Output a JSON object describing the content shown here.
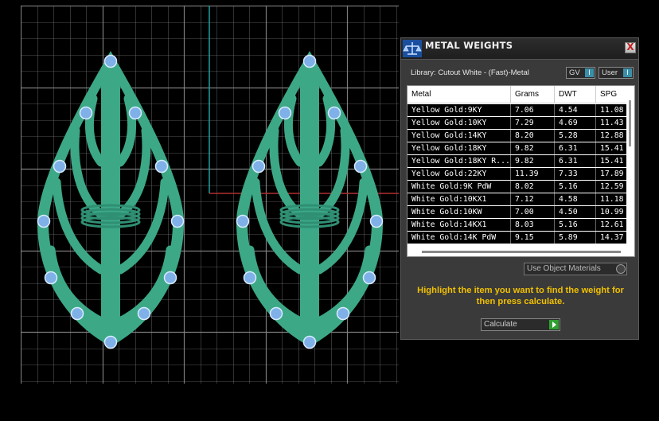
{
  "viewport": {
    "colors": {
      "background": "#000000",
      "grid": "#8a8a8a",
      "axis_x": "#b03030",
      "axis_y": "#20a0a0",
      "model": "#3ca886",
      "model_shade": "#2f8f72",
      "gem": "#7fb0e8"
    }
  },
  "panel": {
    "title": "METAL WEIGHTS",
    "title_icon": "scale-icon",
    "close_label": "X",
    "library_label": "Library: Cutout White - (Fast)-Metal",
    "toggles": {
      "gv": "GV",
      "user": "User"
    },
    "table": {
      "columns": [
        "Metal",
        "Grams",
        "DWT",
        "SPG"
      ],
      "rows": [
        [
          "Yellow Gold:9KY",
          "7.06",
          "4.54",
          "11.08"
        ],
        [
          "Yellow Gold:10KY",
          "7.29",
          "4.69",
          "11.43"
        ],
        [
          "Yellow Gold:14KY",
          "8.20",
          "5.28",
          "12.88"
        ],
        [
          "Yellow Gold:18KY",
          "9.82",
          "6.31",
          "15.41"
        ],
        [
          "Yellow Gold:18KY R...",
          "9.82",
          "6.31",
          "15.41"
        ],
        [
          "Yellow Gold:22KY",
          "11.39",
          "7.33",
          "17.89"
        ],
        [
          "White Gold:9K PdW",
          "8.02",
          "5.16",
          "12.59"
        ],
        [
          "White Gold:10KX1",
          "7.12",
          "4.58",
          "11.18"
        ],
        [
          "White Gold:10KW",
          "7.00",
          "4.50",
          "10.99"
        ],
        [
          "White Gold:14KX1",
          "8.03",
          "5.16",
          "12.61"
        ],
        [
          "White Gold:14K PdW",
          "9.15",
          "5.89",
          "14.37"
        ]
      ]
    },
    "use_object_materials": "Use Object Materials",
    "hint": "Highlight the item you want to find the weight for then press calculate.",
    "calculate_label": "Calculate",
    "accent_color": "#f0c000"
  }
}
